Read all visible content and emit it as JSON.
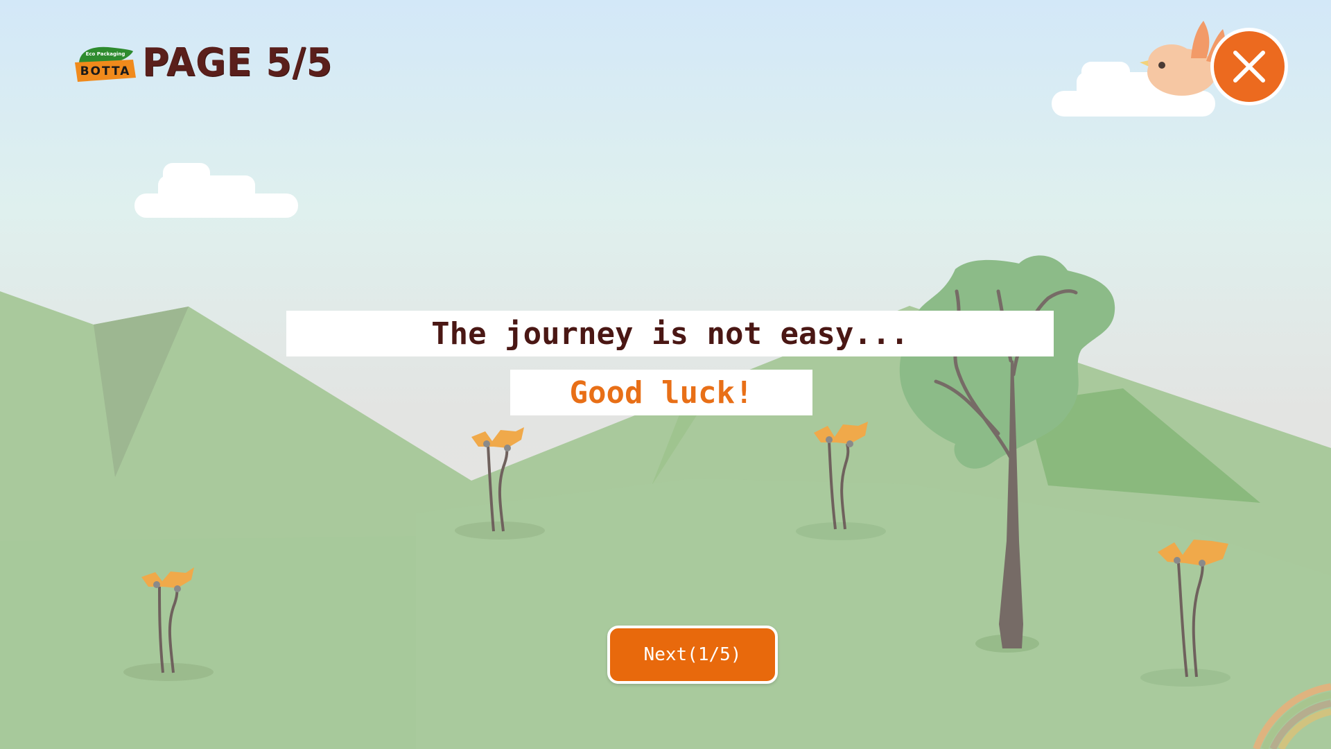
{
  "header": {
    "logo": {
      "tagline": "Eco Packaging",
      "brand": "BOTTA",
      "colors": {
        "leaf": "#2e8b2e",
        "ribbon": "#f08a1c",
        "text": "#1a1a1a"
      }
    },
    "page_indicator": "PAGE 5/5"
  },
  "message": {
    "line1": "The journey is not easy...",
    "line2": "Good luck!"
  },
  "controls": {
    "next_label": "Next(1/5)",
    "close_icon": "close-icon"
  },
  "colors": {
    "accent": "#e8690c",
    "title_text": "#4a1714",
    "sky_top": "#d6eaf8",
    "grass": "#a8c89a",
    "tree_foliage": "#8cbb88",
    "flower": "#f0a94a"
  }
}
